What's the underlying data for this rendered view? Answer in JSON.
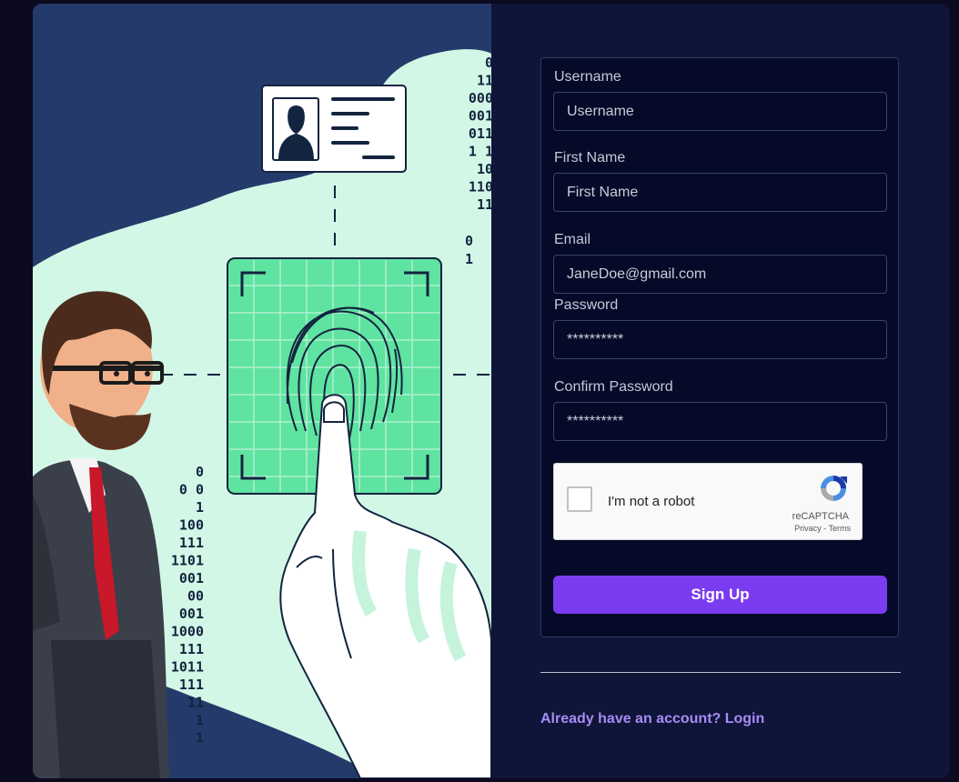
{
  "form": {
    "username": {
      "label": "Username",
      "placeholder": "Username",
      "value": ""
    },
    "first_name": {
      "label": "First Name",
      "placeholder": "First Name",
      "value": ""
    },
    "email": {
      "label": "Email",
      "placeholder": "",
      "value": "JaneDoe@gmail.com"
    },
    "password": {
      "label": "Password",
      "value": "**********"
    },
    "confirm_password": {
      "label": "Confirm Password",
      "value": "**********"
    },
    "submit_label": "Sign Up"
  },
  "captcha": {
    "text": "I'm not a robot",
    "brand": "reCAPTCHA",
    "privacy": "Privacy",
    "separator": " - ",
    "terms": "Terms"
  },
  "footer": {
    "login_text": "Already have an account? Login"
  },
  "illustration": {
    "binary_right": [
      "0",
      "11",
      "000",
      "001",
      "011",
      "1 1",
      "10",
      "110",
      "11",
      "0",
      "1"
    ],
    "binary_left": [
      "0",
      "0  0",
      "1",
      "100",
      "111",
      "1101",
      "001",
      "00",
      "001",
      "1000",
      "111",
      "1011",
      "111",
      "11",
      "1",
      "1"
    ]
  },
  "colors": {
    "accent": "#7b3cf0",
    "link": "#a98bf5",
    "panel_bg": "#050a28",
    "illustration_bg": "#243a6b",
    "blob": "#d3f7e6",
    "scanner": "#5fe3a1"
  }
}
